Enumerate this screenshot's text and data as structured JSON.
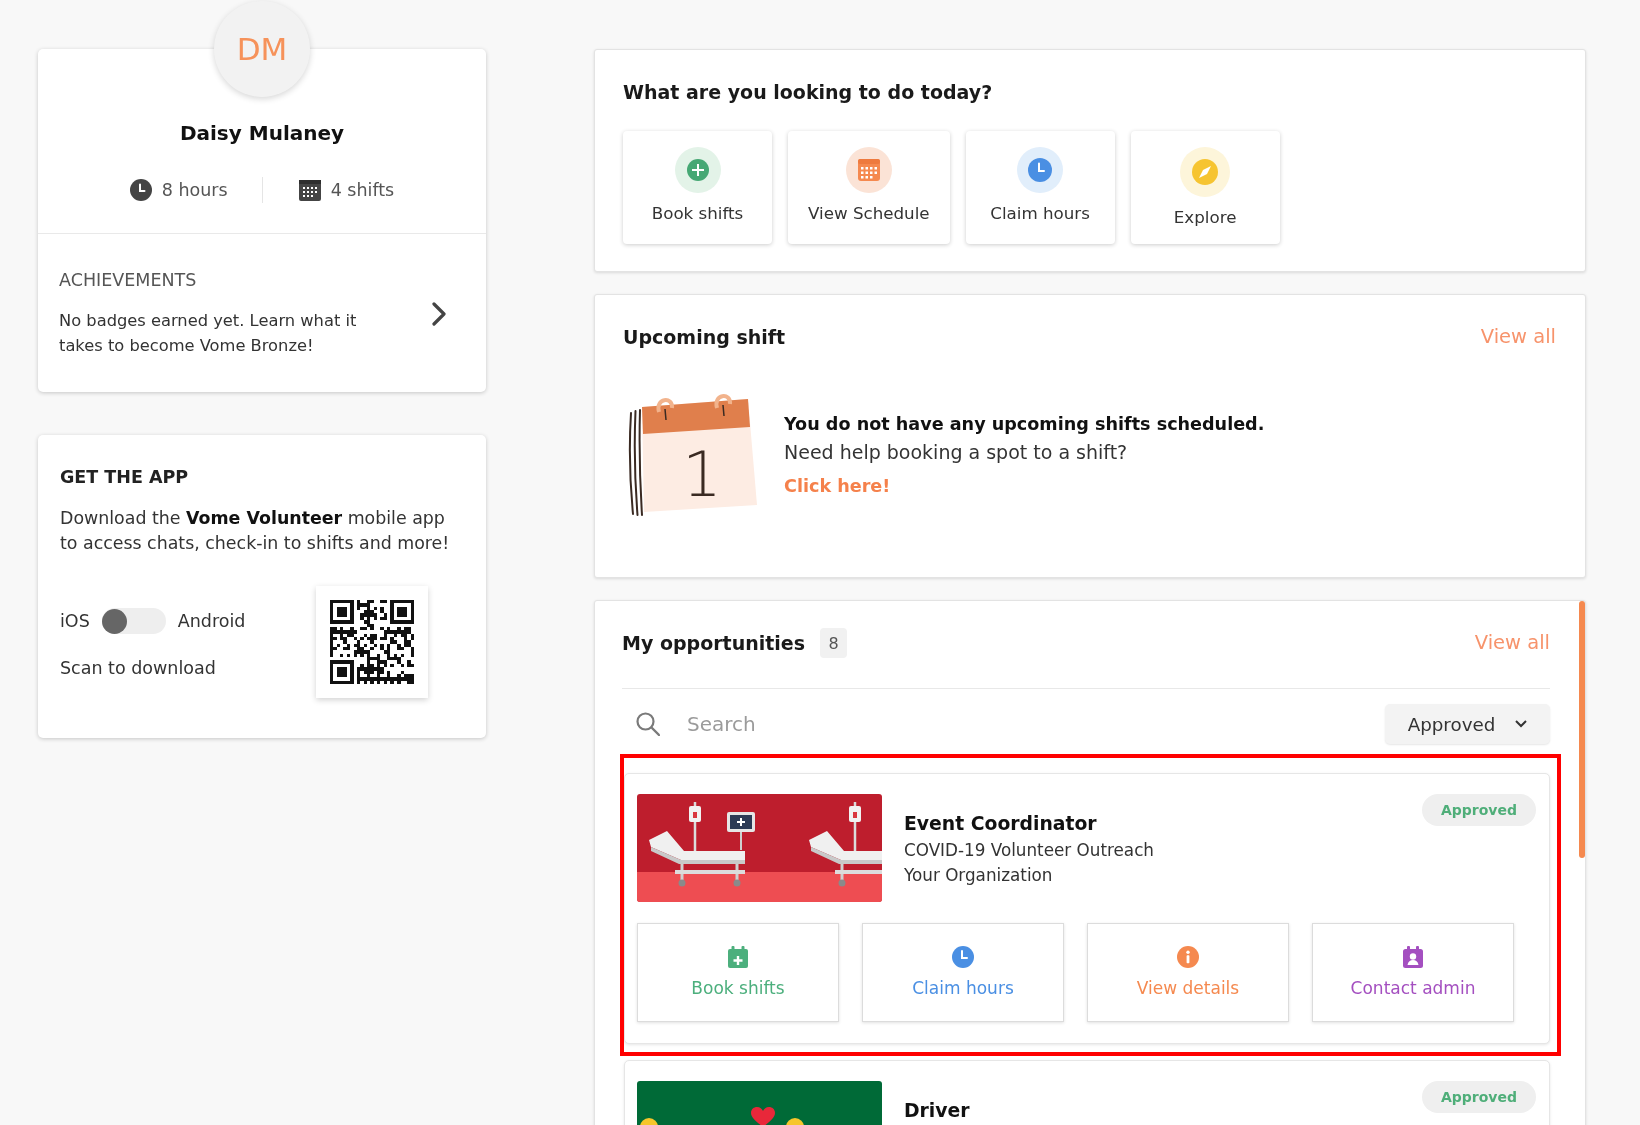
{
  "profile": {
    "initials": "DM",
    "name": "Daisy Mulaney",
    "stats": [
      {
        "kind": "hours",
        "label": "8 hours"
      },
      {
        "kind": "shifts",
        "label": "4 shifts"
      }
    ],
    "achievements": {
      "heading": "ACHIEVEMENTS",
      "text": "No badges earned yet. Learn what it takes to become Vome Bronze!"
    }
  },
  "get_app": {
    "heading": "GET THE APP",
    "text": "Download the **Vome Volunteer** mobile app to access chats, check-in to shifts and more!",
    "toggle": {
      "left": "iOS",
      "right": "Android",
      "on": false
    },
    "scan_label": "Scan to download"
  },
  "quick_actions": {
    "heading": "What are you looking to do today?",
    "items": [
      {
        "kind": "book",
        "label": "Book shifts"
      },
      {
        "kind": "schedule",
        "label": "View Schedule"
      },
      {
        "kind": "claim",
        "label": "Claim hours"
      },
      {
        "kind": "explore",
        "label": "Explore"
      }
    ]
  },
  "upcoming_shift": {
    "heading": "Upcoming shift",
    "view_all": "View all",
    "illustration_day": "1",
    "empty_title": "You do not have any upcoming shifts scheduled.",
    "empty_text": "Need help booking a spot to a shift?",
    "link": "Click here!"
  },
  "opportunities": {
    "heading": "My opportunities",
    "count": "8",
    "view_all": "View all",
    "search": {
      "placeholder": "Search"
    },
    "filter": "Approved",
    "items": [
      {
        "image": {
          "kind": "hospital"
        },
        "title": "Event Coordinator",
        "project": "COVID-19 Volunteer Outreach",
        "organization": "Your Organization",
        "status": "Approved",
        "highlighted": true,
        "actions": [
          {
            "kind": "book",
            "label": "Book shifts"
          },
          {
            "kind": "claim",
            "label": "Claim hours"
          },
          {
            "kind": "details",
            "label": "View details"
          },
          {
            "kind": "contact",
            "label": "Contact admin"
          }
        ]
      },
      {
        "image": {
          "kind": "cars"
        },
        "title": "Driver",
        "status": "Approved",
        "highlighted": false
      }
    ]
  }
}
